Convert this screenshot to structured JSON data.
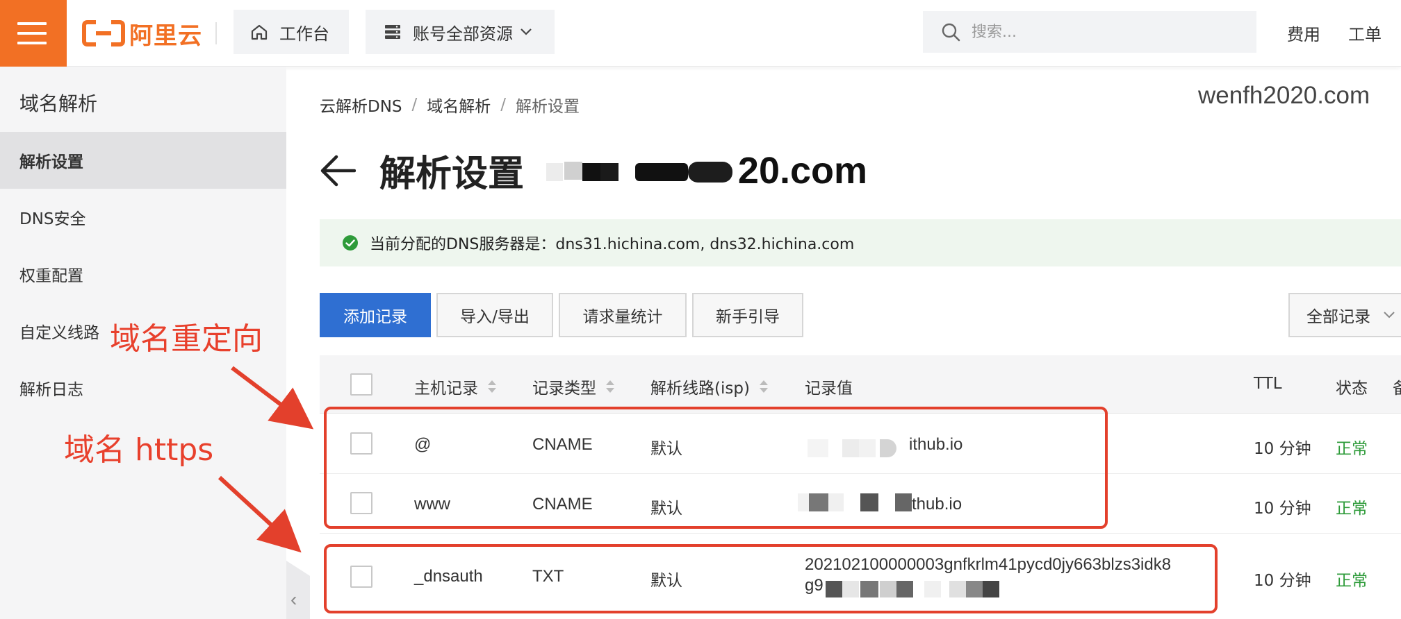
{
  "topbar": {
    "brand": "阿里云",
    "workbench_label": "工作台",
    "resources_label": "账号全部资源",
    "search_placeholder": "搜索...",
    "fee_link": "费用",
    "ticket_link": "工单",
    "brand_color": "#f27024"
  },
  "sidebar": {
    "title": "域名解析",
    "items": [
      {
        "label": "解析设置",
        "active": true
      },
      {
        "label": "DNS安全"
      },
      {
        "label": "权重配置"
      },
      {
        "label": "自定义线路"
      },
      {
        "label": "解析日志"
      }
    ]
  },
  "breadcrumb": [
    "云解析DNS",
    "域名解析",
    "解析设置"
  ],
  "watermark": "wenfh2020.com",
  "page": {
    "title": "解析设置",
    "domain_visible": "20.com"
  },
  "notice": {
    "text": "当前分配的DNS服务器是：dns31.hichina.com, dns32.hichina.com"
  },
  "toolbar": {
    "add_record": "添加记录",
    "import_export": "导入/导出",
    "request_stats": "请求量统计",
    "beginner_guide": "新手引导",
    "filter_selected": "全部记录",
    "primary_color": "#2f6fd2"
  },
  "table": {
    "headers": {
      "host": "主机记录",
      "type": "记录类型",
      "line": "解析线路(isp)",
      "value": "记录值",
      "ttl": "TTL",
      "status": "状态",
      "remark": "备"
    },
    "rows": [
      {
        "host": "@",
        "type": "CNAME",
        "line": "默认",
        "value": "ithub.io",
        "ttl": "10 分钟",
        "status": "正常"
      },
      {
        "host": "www",
        "type": "CNAME",
        "line": "默认",
        "value": "thub.io",
        "ttl": "10 分钟",
        "status": "正常"
      },
      {
        "host": "_dnsauth",
        "type": "TXT",
        "line": "默认",
        "value_line1": "202102100000003gnfkrlm41pycd0jy663blzs3idk8",
        "value_line2": "g9",
        "ttl": "10 分钟",
        "status": "正常"
      }
    ],
    "status_color": "#2e9b3a"
  },
  "annotations": {
    "redirect_label": "域名重定向",
    "https_label": "域名 https",
    "color": "#e3402c"
  }
}
